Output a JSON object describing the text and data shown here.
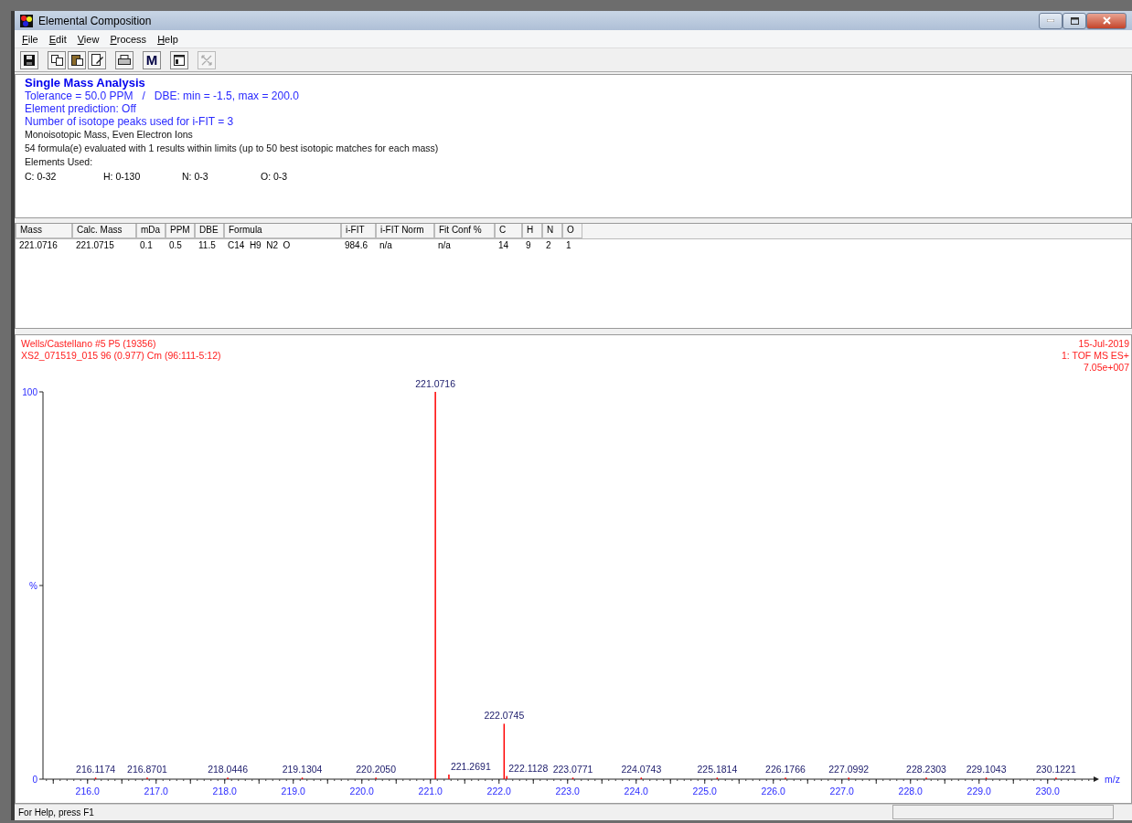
{
  "window": {
    "title": "Elemental Composition"
  },
  "menu": [
    {
      "label": "File"
    },
    {
      "label": "Edit"
    },
    {
      "label": "View"
    },
    {
      "label": "Process"
    },
    {
      "label": "Help"
    }
  ],
  "toolbar": [
    [
      {
        "kind": "save",
        "disabled": false
      }
    ],
    [
      {
        "kind": "copy",
        "disabled": false
      },
      {
        "kind": "paste",
        "disabled": false
      },
      {
        "kind": "edit",
        "disabled": false
      }
    ],
    [
      {
        "kind": "print",
        "disabled": false
      }
    ],
    [
      {
        "kind": "text",
        "label": "M",
        "disabled": false
      }
    ],
    [
      {
        "kind": "window",
        "disabled": false
      }
    ],
    [
      {
        "kind": "fit",
        "disabled": true
      }
    ]
  ],
  "info": {
    "lines": [
      {
        "kind": "heading",
        "text": "Single Mass Analysis"
      },
      {
        "kind": "setting",
        "text": "Tolerance = 50.0 PPM   /   DBE: min = -1.5, max = 200.0"
      },
      {
        "kind": "setting",
        "text": "Element prediction: Off"
      },
      {
        "kind": "setting",
        "text": "Number of isotope peaks used for i-FIT = 3"
      },
      {
        "kind": "note",
        "text": "Monoisotopic Mass, Even Electron Ions"
      },
      {
        "kind": "note",
        "text": "54 formula(e) evaluated with 1 results within limits (up to 50 best isotopic matches for each mass)"
      },
      {
        "kind": "note",
        "text": "Elements Used:"
      }
    ],
    "elements": [
      "C: 0-32",
      "H: 0-130",
      "N: 0-3",
      "O: 0-3"
    ]
  },
  "table": {
    "columns": [
      "Mass",
      "Calc. Mass",
      "mDa",
      "PPM",
      "DBE",
      "Formula",
      "i-FIT",
      "i-FIT Norm",
      "Fit Conf %",
      "C",
      "H",
      "N",
      "O"
    ],
    "rows": [
      [
        "221.0716",
        "221.0715",
        "0.1",
        "0.5",
        "11.5",
        "C14  H9  N2  O",
        "984.6",
        "n/a",
        "n/a",
        "14",
        "9",
        "2",
        "1"
      ]
    ]
  },
  "spectrum": {
    "header_left": [
      "Wells/Castellano  #5  P5  (19356)",
      "XS2_071519_015 96 (0.977) Cm (96:111-5:12)"
    ],
    "header_right": [
      "15-Jul-2019",
      "1: TOF MS ES+",
      "7.05e+007"
    ],
    "chart_data": {
      "type": "bar",
      "xlabel": "m/z",
      "x": [
        216.1174,
        216.8701,
        218.0446,
        219.1304,
        220.205,
        221.0716,
        221.2691,
        222.0745,
        222.1128,
        223.0771,
        224.0743,
        225.1814,
        226.1766,
        227.0992,
        228.2303,
        229.1043,
        230.1221
      ],
      "series": [
        {
          "color": "#ff0000",
          "values": [
            0.4,
            0.4,
            0.4,
            0.4,
            0.4,
            100,
            1.2,
            14.3,
            0.8,
            0.4,
            0.4,
            0.4,
            0.4,
            0.4,
            0.4,
            0.4,
            0.4
          ]
        }
      ],
      "xlim": [
        215.35,
        230.75
      ],
      "ylim": [
        0,
        100
      ],
      "xticks": [
        {
          "value": 216,
          "label": "216.0"
        },
        {
          "value": 217,
          "label": "217.0"
        },
        {
          "value": 218,
          "label": "218.0"
        },
        {
          "value": 219,
          "label": "219.0"
        },
        {
          "value": 220,
          "label": "220.0"
        },
        {
          "value": 221,
          "label": "221.0"
        },
        {
          "value": 222,
          "label": "222.0"
        },
        {
          "value": 223,
          "label": "223.0"
        },
        {
          "value": 224,
          "label": "224.0"
        },
        {
          "value": 225,
          "label": "225.0"
        },
        {
          "value": 226,
          "label": "226.0"
        },
        {
          "value": 227,
          "label": "227.0"
        },
        {
          "value": 228,
          "label": "228.0"
        },
        {
          "value": 229,
          "label": "229.0"
        },
        {
          "value": 230,
          "label": "230.0"
        }
      ],
      "yticks": [
        {
          "value": 0,
          "label": "0"
        },
        {
          "value": 50,
          "label": "%"
        },
        {
          "value": 100,
          "label": "100"
        }
      ],
      "value_labels": [
        "216.1174",
        "216.8701",
        "218.0446",
        "219.1304",
        "220.2050",
        "221.0716",
        "221.2691",
        "222.0745",
        "222.1128",
        "223.0771",
        "224.0743",
        "225.1814",
        "226.1766",
        "227.0992",
        "228.2303",
        "229.1043",
        "230.1221"
      ]
    }
  },
  "status_bar": {
    "text": "For Help, press F1"
  }
}
